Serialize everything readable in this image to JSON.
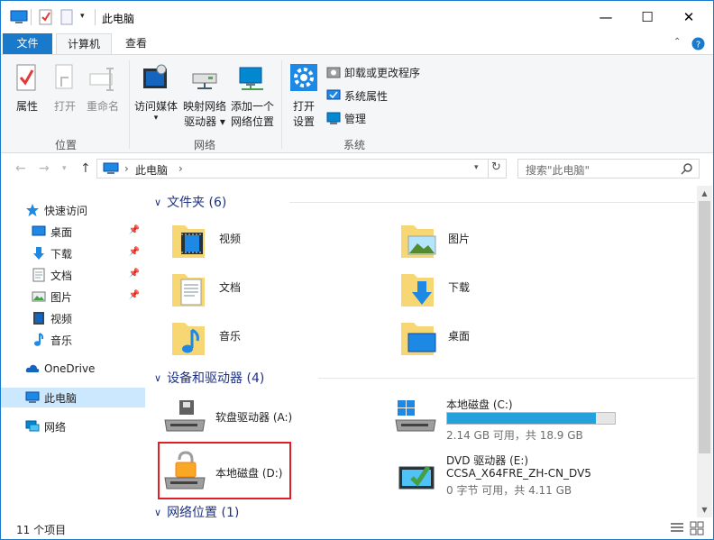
{
  "window": {
    "title": "此电脑",
    "minimize": "—",
    "maximize": "☐",
    "close": "✕"
  },
  "ribbon_tabs": {
    "file": "文件",
    "computer": "计算机",
    "view": "查看"
  },
  "ribbon": {
    "location_group": {
      "label": "位置",
      "properties": "属性",
      "open": "打开",
      "rename": "重命名"
    },
    "network_group": {
      "label": "网络",
      "access_media_l1": "访问媒体",
      "access_media_l2": "▾",
      "map_drive_l1": "映射网络",
      "map_drive_l2": "驱动器 ▾",
      "add_location_l1": "添加一个",
      "add_location_l2": "网络位置"
    },
    "system_group": {
      "label": "系统",
      "open_settings_l1": "打开",
      "open_settings_l2": "设置",
      "uninstall": "卸载或更改程序",
      "system_properties": "系统属性",
      "manage": "管理"
    }
  },
  "address_bar": {
    "path": "此电脑",
    "sep": "›",
    "search_placeholder": "搜索\"此电脑\""
  },
  "nav_pane": {
    "quick_access": "快速访问",
    "desktop": "桌面",
    "downloads": "下载",
    "documents": "文档",
    "pictures": "图片",
    "videos": "视频",
    "music": "音乐",
    "onedrive": "OneDrive",
    "this_pc": "此电脑",
    "network": "网络"
  },
  "sections": {
    "folders": "文件夹 (6)",
    "devices": "设备和驱动器 (4)",
    "network_locations": "网络位置 (1)"
  },
  "folders": {
    "videos": "视频",
    "pictures": "图片",
    "documents": "文档",
    "downloads": "下载",
    "music": "音乐",
    "desktop": "桌面"
  },
  "drives": {
    "floppy": {
      "name": "软盘驱动器 (A:)"
    },
    "c": {
      "name": "本地磁盘 (C:)",
      "free": "2.14 GB 可用，共 18.9 GB",
      "used_fraction": 0.887
    },
    "d": {
      "name": "本地磁盘 (D:)"
    },
    "dvd": {
      "name": "DVD 驱动器 (E:)",
      "label": "CCSA_X64FRE_ZH-CN_DV5",
      "free": "0 字节 可用，共 4.11 GB"
    }
  },
  "status": {
    "items": "11 个项目"
  },
  "colors": {
    "accent": "#1979ca",
    "selection": "#cce8ff",
    "highlight_box": "#e21f26",
    "drive_bar": "#26a0da"
  }
}
